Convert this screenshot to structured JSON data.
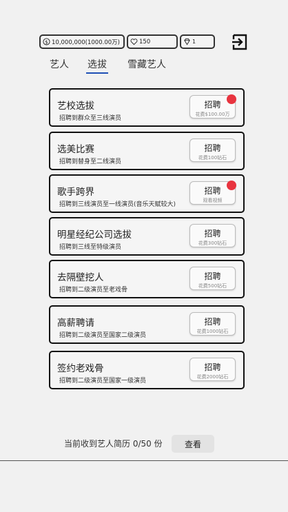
{
  "stats": {
    "money": "10,000,000(1000.00万)",
    "hearts": "150",
    "diamonds": "1"
  },
  "icons": {
    "money": "dollar-coin-icon",
    "heart": "heart-icon",
    "diamond": "diamond-icon",
    "exit": "exit-icon"
  },
  "tabs": [
    {
      "label": "艺人"
    },
    {
      "label": "选拔"
    },
    {
      "label": "雪藏艺人"
    }
  ],
  "cards": [
    {
      "title": "艺校选拔",
      "desc": "招聘到群众至三线演员",
      "button": "招聘",
      "cost": "花费$100.00万",
      "badge": true
    },
    {
      "title": "选美比赛",
      "desc": "招聘到替身至二线演员",
      "button": "招聘",
      "cost": "花费100钻石",
      "badge": false
    },
    {
      "title": "歌手跨界",
      "desc": "招聘到三线演员至一线演员(音乐天赋较大)",
      "button": "招聘",
      "cost": "观看视频",
      "badge": true
    },
    {
      "title": "明星经纪公司选拔",
      "desc": "招聘到三线至特级演员",
      "button": "招聘",
      "cost": "花费300钻石",
      "badge": false
    },
    {
      "title": "去隔壁挖人",
      "desc": "招聘到二级演员至老戏骨",
      "button": "招聘",
      "cost": "花费500钻石",
      "badge": false
    },
    {
      "title": "高薪聘请",
      "desc": "招聘到二级演员至国家二级演员",
      "button": "招聘",
      "cost": "花费1000钻石",
      "badge": false
    },
    {
      "title": "签约老戏骨",
      "desc": "招聘到二级演员至国家一级演员",
      "button": "招聘",
      "cost": "花费2000钻石",
      "badge": false
    }
  ],
  "footer": {
    "resume_text": "当前收到艺人简历 0/50 份",
    "view_label": "查看"
  },
  "colors": {
    "active_tab_underline": "#1e4fb5",
    "badge": "#e8343f",
    "background": "#f1f1f1"
  }
}
